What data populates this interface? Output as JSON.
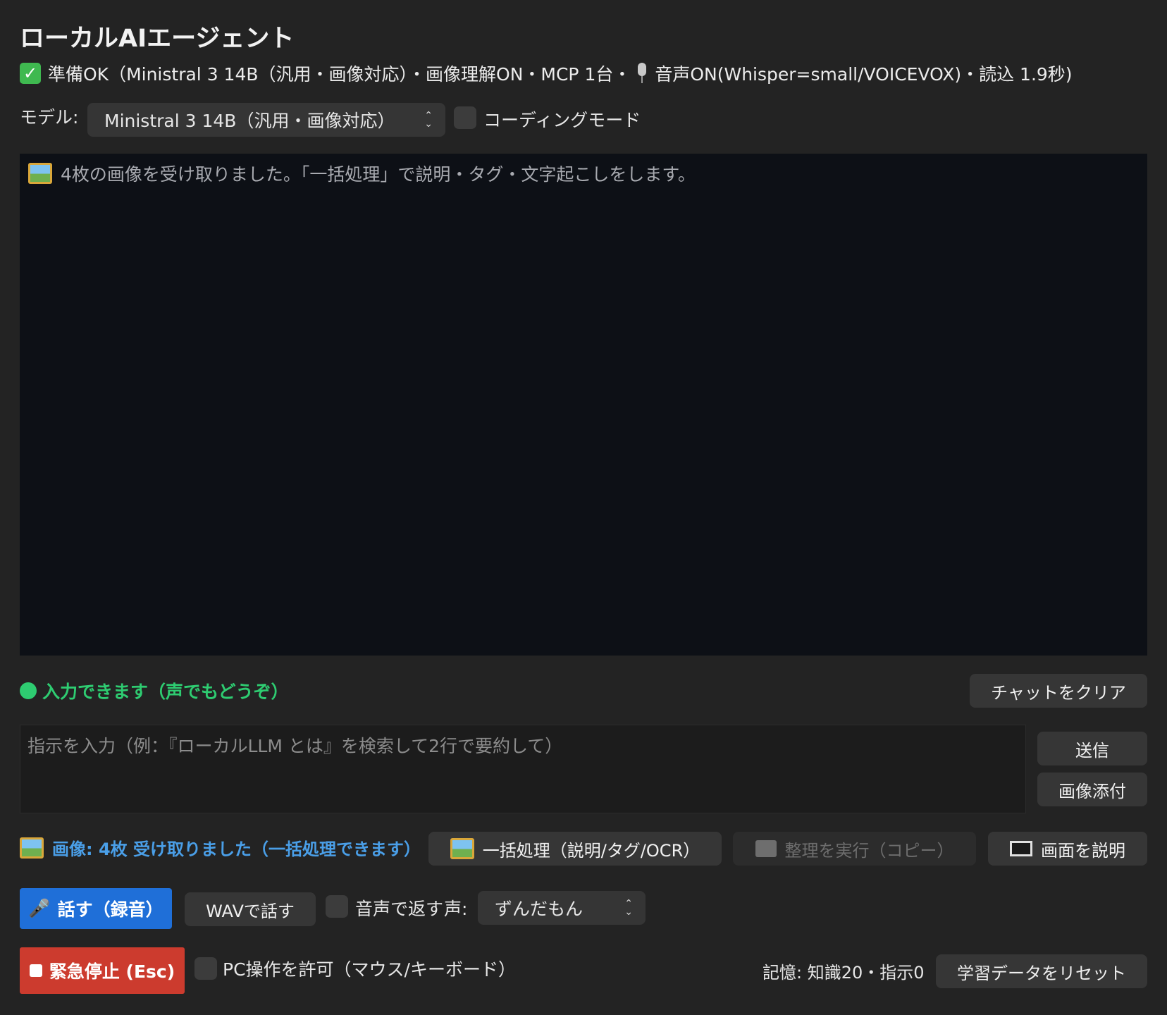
{
  "app": {
    "title": "ローカルAIエージェント"
  },
  "status": {
    "check_icon": "check-mark-button-emoji",
    "part1": "準備OK（Ministral 3 14B（汎用・画像対応）・画像理解ON・MCP 1台・",
    "mic_icon": "studio-microphone-emoji",
    "part2": "音声ON(Whisper=small/VOICEVOX)・読込 1.9秒)"
  },
  "model": {
    "label": "モデル:",
    "selected": "Ministral 3 14B（汎用・画像対応）"
  },
  "coding_mode": {
    "label": "コーディングモード",
    "checked": false
  },
  "chat": {
    "messages": [
      {
        "icon": "framed-picture-emoji",
        "text": "4枚の画像を受け取りました。「一括処理」で説明・タグ・文字起こしをします。"
      }
    ]
  },
  "ready_status": {
    "text": "入力できます（声でもどうぞ）",
    "color": "#2ecc71"
  },
  "buttons": {
    "clear_chat": "チャットをクリア",
    "send": "送信",
    "attach_image": "画像添付",
    "batch": "一括処理（説明/タグ/OCR）",
    "organize": "整理を実行（コピー）",
    "describe_screen": "画面を説明",
    "talk": "話す（録音）",
    "wav_talk": "WAVで話す",
    "emergency_stop": "緊急停止 (Esc)",
    "reset_learning": "学習データをリセット"
  },
  "input": {
    "placeholder": "指示を入力（例：『ローカルLLM とは』を検索して2行で要約して）",
    "value": ""
  },
  "images_status": "画像: 4枚 受け取りました（一括処理できます）",
  "voice_reply": {
    "label": "音声で返す",
    "checked": false
  },
  "voice": {
    "label": "声:",
    "selected": "ずんだもん"
  },
  "pc_control": {
    "label": "PC操作を許可（マウス/キーボード）",
    "checked": false
  },
  "memory": "記憶: 知識20・指示0",
  "colors": {
    "talk_button": "#1f6fd8",
    "stop_button": "#cc3b2e",
    "images_status": "#4a9fe8"
  }
}
